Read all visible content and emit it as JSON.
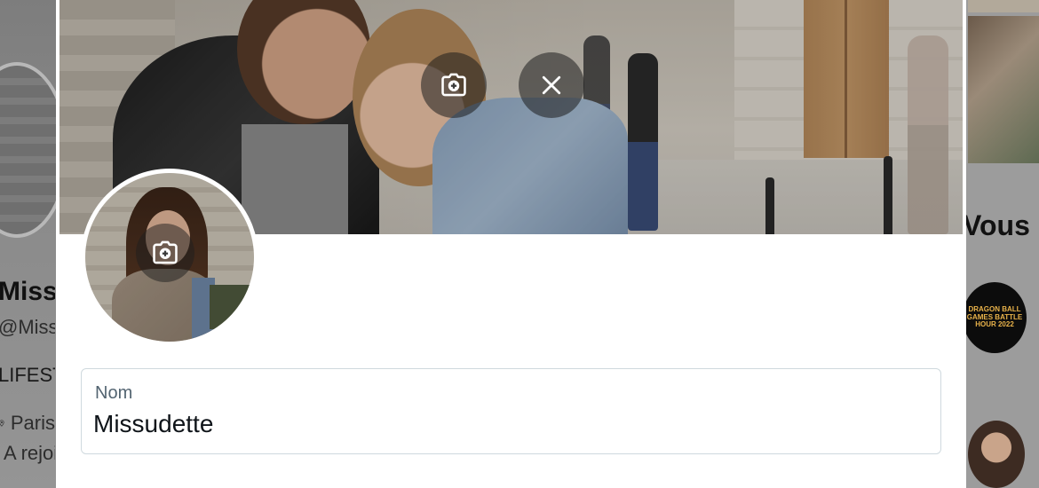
{
  "background_profile": {
    "name": "Missudette",
    "handle": "@Missudette",
    "bio": "LIFESTYLE",
    "location": "Paris",
    "joined": "A rejoint"
  },
  "background_sidebar": {
    "heading": "Vous pourriez aimer",
    "suggestion_logo_text": "DRAGON BALL GAMES BATTLE HOUR 2022"
  },
  "edit_profile": {
    "banner": {
      "camera_icon": "camera-plus-icon",
      "close_icon": "close-icon"
    },
    "avatar": {
      "camera_icon": "camera-plus-icon"
    },
    "name_field": {
      "label": "Nom",
      "value": "Missudette"
    }
  },
  "colors": {
    "field_border": "#cfd9de",
    "label": "#536471",
    "text": "#0f1419",
    "overlay_button": "rgba(30,30,30,0.55)"
  }
}
